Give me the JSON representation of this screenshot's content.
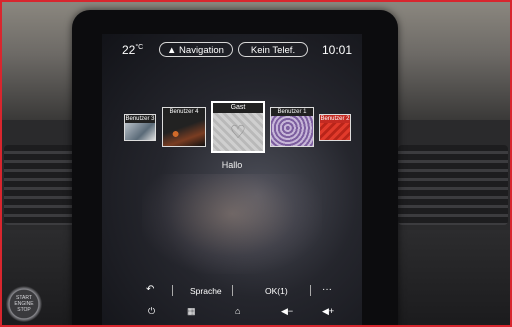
{
  "status_bar": {
    "temperature": "22",
    "temperature_unit": "°C",
    "navigation_label": "Navigation",
    "phone_label": "Kein Telef.",
    "time": "10:01"
  },
  "profiles": [
    {
      "label": "Benutzer 3"
    },
    {
      "label": "Benutzer 4"
    },
    {
      "label": "Gast"
    },
    {
      "label": "Benutzer 1"
    },
    {
      "label": "Benutzer 2"
    }
  ],
  "greeting": "Hallo",
  "quick_bar": {
    "back_icon": "back-arrow-icon",
    "language_label": "Sprache",
    "ok_label": "OK(1)",
    "more_label": "···"
  },
  "bottom_bar": {
    "icons": [
      "power-icon",
      "apps-grid-icon",
      "home-icon",
      "volume-down-icon",
      "volume-up-icon"
    ]
  },
  "start_button": {
    "line1": "START",
    "line2": "ENGINE",
    "line3": "STOP"
  }
}
